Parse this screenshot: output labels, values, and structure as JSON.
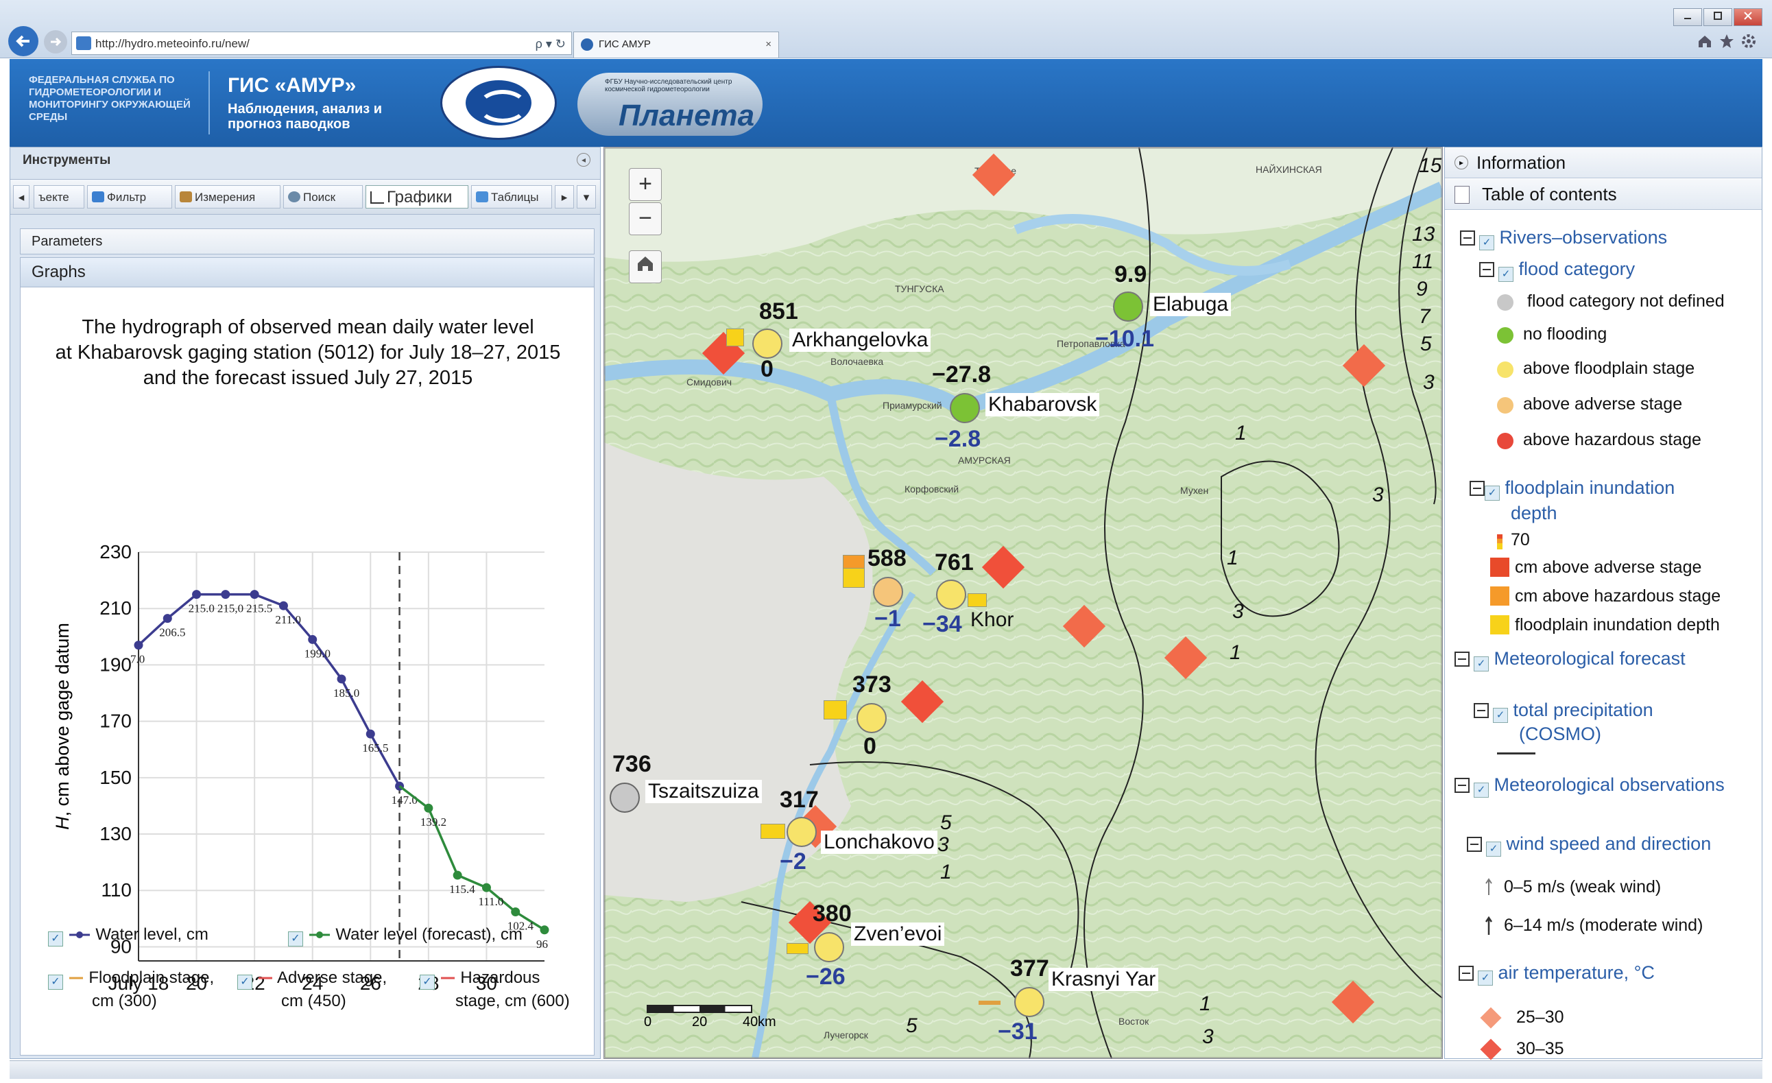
{
  "browser": {
    "url": "http://hydro.meteoinfo.ru/new/",
    "tab_title": "ГИС АМУР",
    "tab_close": "×",
    "addr_tools": "ρ ▾ ↻"
  },
  "header": {
    "agency": "ФЕДЕРАЛЬНАЯ СЛУЖБА ПО ГИДРОМЕТЕОРОЛОГИИ И МОНИТОРИНГУ ОКРУЖАЮЩЕЙ СРЕДЫ",
    "title": "ГИС «АМУР»",
    "subtitle": "Наблюдения, анализ и прогноз паводков",
    "logo2_small": "ФГБУ Научно-исследовательский центр космической гидрометеорологии",
    "logo2_name": "Планета"
  },
  "left": {
    "tools_title": "Инструменты",
    "toolbar": {
      "scroll_left": "◂",
      "objects": "ъекте",
      "filter": "Фильтр",
      "measure": "Измерения",
      "search": "Поиск",
      "graphs": "Графики",
      "tables": "Таблицы",
      "scroll_right": "▸",
      "dropdown": "▾"
    },
    "parameters": "Parameters",
    "graphs": "Graphs"
  },
  "chart_data": {
    "type": "line",
    "title": "The hydrograph of observed mean daily water level at Khabarovsk gaging station (5012) for July 18–27, 2015 and the forecast issued July 27, 2015",
    "title_lines": [
      "The hydrograph of observed mean daily water level",
      "at Khabarovsk gaging station (5012) for July 18–27, 2015",
      "and the forecast issued July 27, 2015"
    ],
    "ylabel_italic": "H",
    "ylabel_rest": ", cm above gage datum",
    "ylim": [
      85,
      230
    ],
    "yticks": [
      90,
      110,
      130,
      150,
      170,
      190,
      210,
      230
    ],
    "xlim": [
      18,
      32
    ],
    "xticks": [
      {
        "x": 18,
        "label": "July 18"
      },
      {
        "x": 20,
        "label": "20"
      },
      {
        "x": 22,
        "label": "22"
      },
      {
        "x": 24,
        "label": "24"
      },
      {
        "x": 26,
        "label": "26"
      },
      {
        "x": 28,
        "label": "28"
      },
      {
        "x": 30,
        "label": "30"
      }
    ],
    "forecast_issue_x": 27,
    "series": [
      {
        "name": "Water level, cm",
        "color": "#3c3c8f",
        "x": [
          18,
          19,
          20,
          21,
          22,
          23,
          24,
          25,
          26,
          27
        ],
        "y": [
          197.0,
          206.5,
          215.0,
          215.0,
          215.0,
          211.0,
          199.0,
          185.0,
          165.5,
          147.0
        ],
        "labels": [
          "7.0",
          "206.5",
          "215.0",
          "215,0",
          "215.5",
          "211.0",
          "199.0",
          "185.0",
          "165.5",
          "147.0"
        ]
      },
      {
        "name": "Water level (forecast), cm",
        "color": "#2e8b3c",
        "x": [
          27,
          28,
          29,
          30,
          31,
          32
        ],
        "y": [
          147.0,
          139.2,
          115.4,
          111.0,
          102.4,
          96.0
        ],
        "labels": [
          "",
          "139.2",
          "115.4",
          "111.0",
          "102.4",
          "96"
        ]
      }
    ],
    "legend": {
      "water_level": "Water level, cm",
      "water_forecast": "Water level (forecast), cm",
      "floodplain_1": "Floodplain stage,",
      "floodplain_2": "cm (300)",
      "adverse_1": "Adverse stage,",
      "adverse_2": "cm (450)",
      "hazardous_1": "Hazardous",
      "hazardous_2": "stage,  cm (600)",
      "floodplain_color": "#e0a040",
      "adverse_color": "#e05050",
      "hazardous_color": "#e05050"
    }
  },
  "map": {
    "zoom_in": "+",
    "zoom_out": "−",
    "home": "⌂",
    "scale": {
      "ticks": [
        "0",
        "20",
        "40"
      ],
      "unit": "km"
    },
    "stations": [
      {
        "name": "Arkhangelovka",
        "value": "851",
        "delta": "0",
        "color": "#f7e36a"
      },
      {
        "name": "Elabuga",
        "value": "9.9",
        "delta": "−10.1",
        "color": "#7cc235"
      },
      {
        "name": "Khabarovsk",
        "value": "−27.8",
        "delta": "−2.8",
        "color": "#7cc235"
      },
      {
        "name": "",
        "value": "588",
        "delta": "−1",
        "color": "#f5c57a"
      },
      {
        "name": "Khor",
        "value": "761",
        "delta": "−34",
        "color": "#f7e36a"
      },
      {
        "name": "",
        "value": "373",
        "delta": "0",
        "color": "#f7e36a"
      },
      {
        "name": "Tszaitszuiza",
        "value": "736",
        "delta": "",
        "color": "#c8c8c8"
      },
      {
        "name": "Lonchakovo",
        "value": "317",
        "delta": "−2",
        "color": "#f7e36a"
      },
      {
        "name": "Zven’evoi",
        "value": "380",
        "delta": "−26",
        "color": "#f7e36a"
      },
      {
        "name": "Krasnyi Yar",
        "value": "377",
        "delta": "−31",
        "color": "#f7e36a"
      }
    ],
    "contours": [
      "15",
      "13",
      "11",
      "9",
      "7",
      "5",
      "3",
      "1",
      "3",
      "1",
      "3",
      "1",
      "5",
      "3",
      "1",
      "1",
      "3",
      "5"
    ],
    "place_names": [
      "Смидович",
      "Волочаевка",
      "Приамурский",
      "Петропавловка",
      "Корфовский",
      "ТУНГУСКА",
      "АМУРСКАЯ",
      "Мухен",
      "Лучегорск",
      "Восток",
      "НАЙХИНСКАЯ",
      "Троицкое"
    ]
  },
  "right": {
    "information": "Information",
    "toc": "Table of contents",
    "rivers": "Rivers–observations",
    "flood_category": "flood category",
    "fc_undefined": "flood category not defined",
    "fc_none": "no flooding",
    "fc_floodplain": "above floodplain stage",
    "fc_adverse": "above adverse stage",
    "fc_hazard": "above hazardous stage",
    "inund_1": "floodplain inundation",
    "inund_2": "depth",
    "inund_val": "70",
    "inund_adverse": "cm above adverse stage",
    "inund_hazard": "cm above hazardous stage",
    "inund_depth": "floodplain inundation depth",
    "met_forecast": "Meteorological forecast",
    "precip_1": "total precipitation",
    "precip_2": "(COSMO)",
    "met_obs": "Meteorological observations",
    "wind": "wind speed and direction",
    "wind_weak": "0–5 m/s (weak wind)",
    "wind_mod": "6–14 m/s (moderate wind)",
    "air_temp": "air temperature, °C",
    "t1": "25–30",
    "t2": "30–35",
    "colors": {
      "undefined": "#c8c8c8",
      "none": "#7cc235",
      "floodplain": "#f7e36a",
      "adverse": "#f5c57a",
      "hazard": "#e8483a",
      "inund_adverse": "#e84a2a",
      "inund_hazard": "#f59a2a",
      "inund_depth": "#f7d21a",
      "t1": "#f59a7a",
      "t2": "#ee5a4a"
    }
  }
}
